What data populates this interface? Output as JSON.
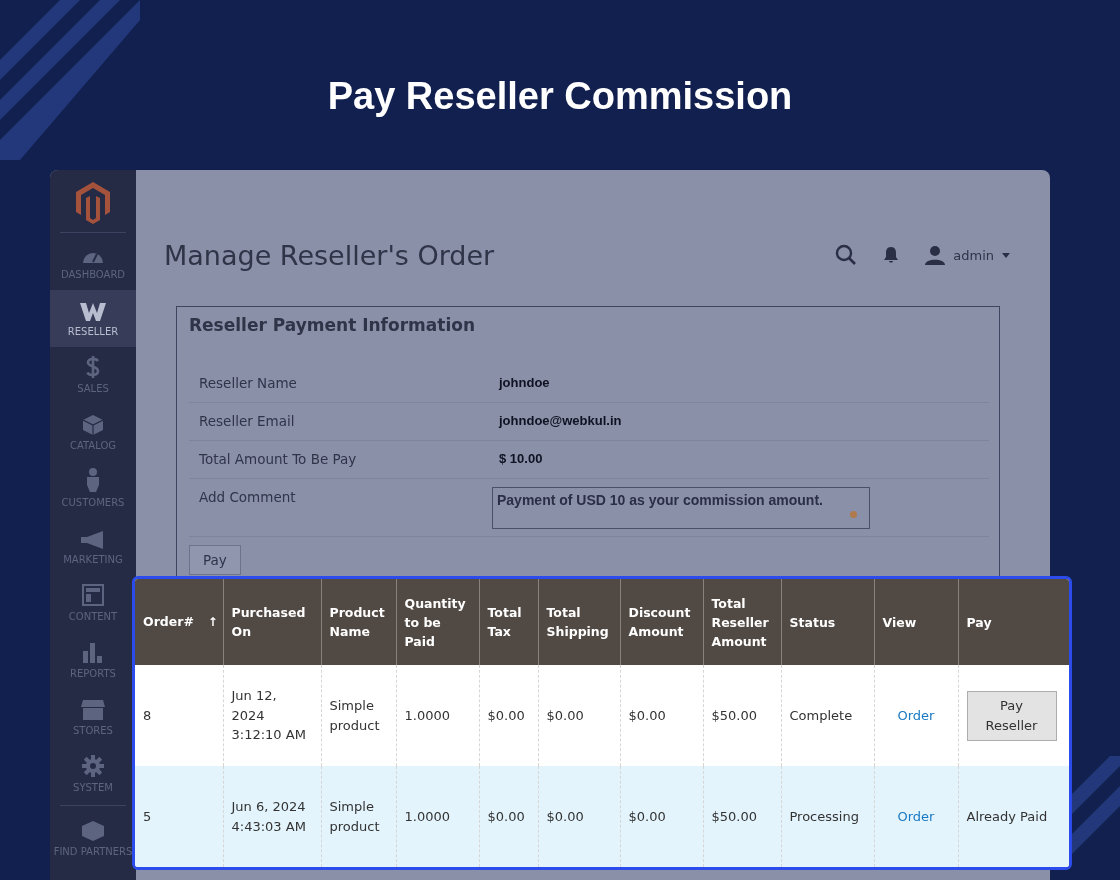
{
  "banner": {
    "title": "Pay Reseller Commission"
  },
  "sidebar": {
    "items": [
      {
        "label": "DASHBOARD",
        "selected": false
      },
      {
        "label": "RESELLER",
        "selected": true
      },
      {
        "label": "SALES",
        "selected": false
      },
      {
        "label": "CATALOG",
        "selected": false
      },
      {
        "label": "CUSTOMERS",
        "selected": false
      },
      {
        "label": "MARKETING",
        "selected": false
      },
      {
        "label": "CONTENT",
        "selected": false
      },
      {
        "label": "REPORTS",
        "selected": false
      },
      {
        "label": "STORES",
        "selected": false
      },
      {
        "label": "SYSTEM",
        "selected": false
      },
      {
        "label": "FIND PARTNERS",
        "selected": false
      }
    ]
  },
  "header": {
    "title": "Manage Reseller's Order",
    "user": "admin"
  },
  "payment_info": {
    "title": "Reseller Payment Information",
    "rows": [
      {
        "label": "Reseller Name",
        "kind": "text",
        "value": "johndoe"
      },
      {
        "label": "Reseller Email",
        "kind": "text",
        "value": "johndoe@webkul.in"
      },
      {
        "label": "Total Amount To Be Pay",
        "kind": "text",
        "value": "$ 10.00"
      },
      {
        "label": "Add Comment",
        "kind": "textarea",
        "value": "Payment of USD 10 as your commission amount."
      }
    ],
    "button": "Pay"
  },
  "table": {
    "columns": [
      {
        "label": "Order#",
        "sort": "↑"
      },
      {
        "label": "Purchased On"
      },
      {
        "label": "Product Name"
      },
      {
        "label": "Quantity to be Paid"
      },
      {
        "label": "Total Tax"
      },
      {
        "label": "Total Shipping"
      },
      {
        "label": "Discount Amount"
      },
      {
        "label": "Total Reseller Amount"
      },
      {
        "label": "Status"
      },
      {
        "label": "View"
      },
      {
        "label": "Pay"
      }
    ],
    "rows": [
      {
        "selected": false,
        "cells": [
          "8",
          "Jun 12, 2024 3:12:10 AM",
          "Simple product",
          "1.0000",
          "$0.00",
          "$0.00",
          "$0.00",
          "$50.00",
          "Complete"
        ],
        "view": "Order",
        "pay": {
          "kind": "button",
          "label": "Pay Reseller"
        }
      },
      {
        "selected": true,
        "cells": [
          "5",
          "Jun 6, 2024 4:43:03 AM",
          "Simple product",
          "1.0000",
          "$0.00",
          "$0.00",
          "$0.00",
          "$50.00",
          "Processing"
        ],
        "view": "Order",
        "pay": {
          "kind": "text",
          "label": "Already Paid"
        }
      }
    ]
  }
}
